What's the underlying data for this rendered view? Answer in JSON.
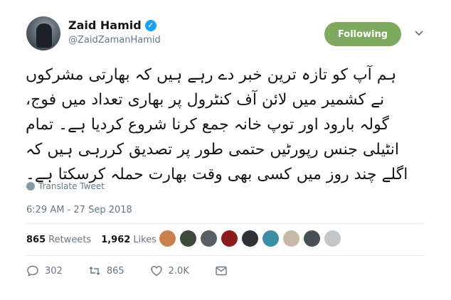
{
  "author": {
    "name": "Zaid Hamid",
    "handle": "@ZaidZamanHamid",
    "verified": true
  },
  "follow_button": {
    "label": "Following",
    "color": "#7fa961"
  },
  "tweet": {
    "text": "ہم آپ کو تازہ ترین خبر دے رہے ہیں کہ بھارتی مشرکوں نے کشمیر میں لائن آف کنٹرول پر بھاری تعداد میں فوج، گولہ بارود اور توپ خانہ جمع کرنا شروع کردیا ہے۔ تمام انٹیلی جنس رپورٹیں حتمی طور پر تصدیق کررہی ہیں کہ اگلے چند روز میں کسی بھی وقت بھارت حملہ کرسکتا ہے۔",
    "translate_label": "Translate Tweet",
    "timestamp": "6:29 AM - 27 Sep 2018"
  },
  "stats": {
    "retweets_count": "865",
    "retweets_label": "Retweets",
    "likes_count": "1,962",
    "likes_label": "Likes"
  },
  "liker_avatars": [
    "#c9804e",
    "#3b4a3a",
    "#5a5f63",
    "#8b1c1c",
    "#2e3338",
    "#3c8fa3",
    "#c8b8a8",
    "#4a4f55",
    "#c4c7ca"
  ],
  "actions": {
    "reply_count": "302",
    "retweet_count": "865",
    "like_count": "2.0K"
  }
}
